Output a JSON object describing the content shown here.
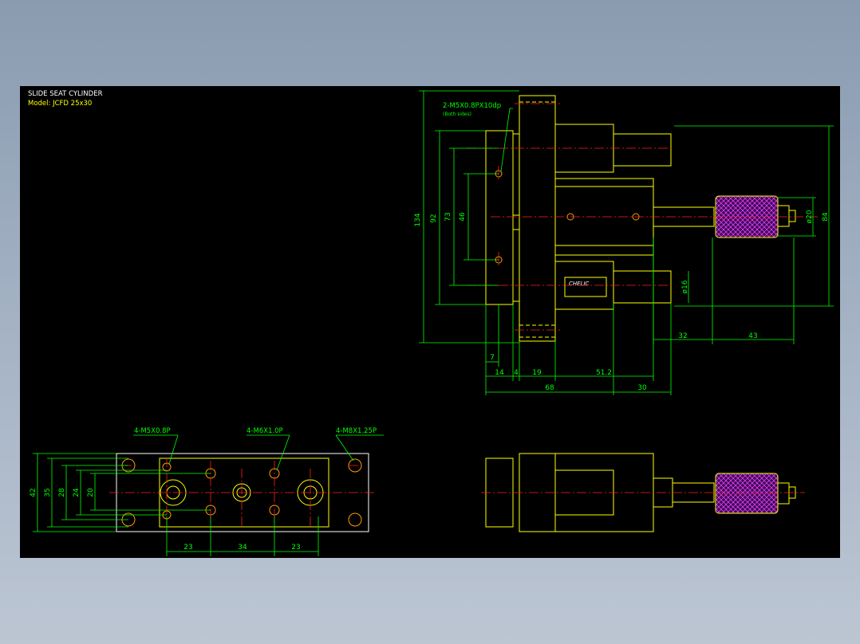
{
  "title_block": {
    "title": "SLIDE SEAT CYLINDER",
    "model": "Model:  JCFD  25x30"
  },
  "notes": {
    "side_tap": "2-M5X0.8PX10dp",
    "side_tap_sub": "(Both sides)",
    "hole_m5": "4-M5X0.8P",
    "hole_m6": "4-M6X1.0P",
    "hole_m8": "4-M8X1.25P",
    "brand": "CHELIC"
  },
  "dimensions": {
    "h134": "134",
    "h92": "92",
    "h73": "73",
    "h46": "46",
    "d20": "ø20",
    "h84": "84",
    "d16": "ø16",
    "w32": "32",
    "w43": "43",
    "w7": "7",
    "w14": "14",
    "w4": "4",
    "w19": "19",
    "w512": "51.2",
    "w68": "68",
    "w30": "30",
    "b42": "42",
    "b35": "35",
    "b28": "28",
    "b24": "24",
    "b20": "20",
    "b23a": "23",
    "b34": "34",
    "b23b": "23"
  },
  "colors": {
    "background": "#000000",
    "outline": "#ffff00",
    "dimension": "#00ff00",
    "centerline": "#ff2020",
    "knurl": "#ff00ff"
  }
}
